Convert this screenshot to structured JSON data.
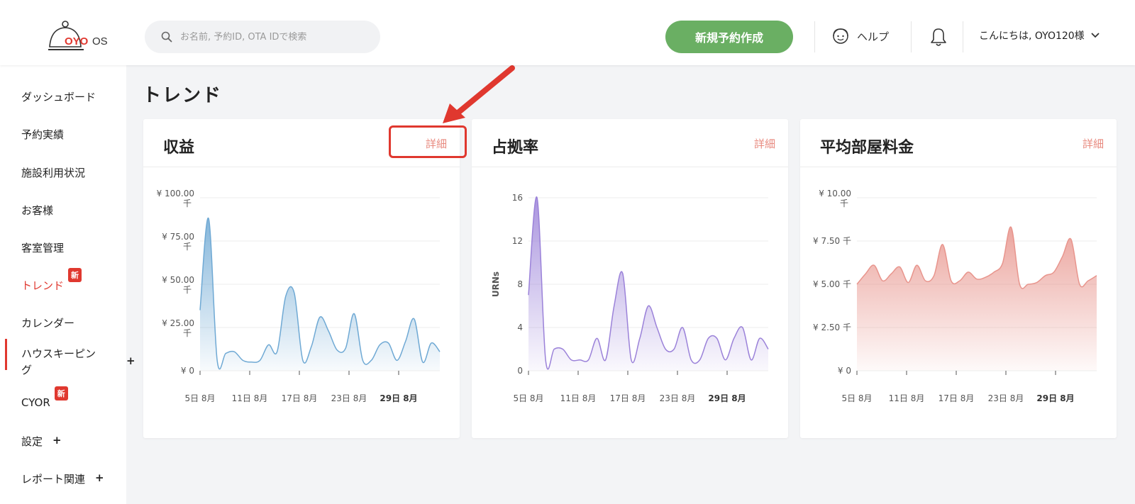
{
  "header": {
    "logo_text": "OYO OS",
    "search_placeholder": "お名前, 予約ID, OTA IDで検索",
    "new_booking_label": "新規予約作成",
    "help_label": "ヘルプ",
    "greeting": "こんにちは, OYO120様"
  },
  "sidebar": {
    "items": [
      {
        "label": "ダッシュボード"
      },
      {
        "label": "予約実績"
      },
      {
        "label": "施設利用状況"
      },
      {
        "label": "お客様"
      },
      {
        "label": "客室管理"
      },
      {
        "label": "トレンド",
        "badge": "新"
      },
      {
        "label": "カレンダー"
      },
      {
        "label": "ハウスキーピング",
        "line1": "ハウスキーピン",
        "line2": "グ",
        "plus": "+"
      },
      {
        "label": "CYOR",
        "badge": "新"
      },
      {
        "label": "設定",
        "plus": "+"
      },
      {
        "label": "レポート関連",
        "plus": "+"
      }
    ]
  },
  "main": {
    "title": "トレンド",
    "detail_label": "詳細"
  },
  "colors": {
    "accent_green": "#6aaf63",
    "accent_red": "#e0382f",
    "revenue": "#6fa9d4",
    "occupancy": "#9b82d9",
    "adr": "#e8958d"
  },
  "chart_data": [
    {
      "type": "area",
      "title": "収益",
      "ylabel": "",
      "ylim": [
        0,
        100
      ],
      "yticks": [
        {
          "value": 100,
          "line1": "¥ 100.00",
          "line2": "千"
        },
        {
          "value": 75,
          "line1": "¥ 75.00",
          "line2": "千"
        },
        {
          "value": 50,
          "line1": "¥ 50.00",
          "line2": "千"
        },
        {
          "value": 25,
          "line1": "¥ 25.00",
          "line2": "千"
        },
        {
          "value": 0,
          "line1": "¥ 0",
          "line2": ""
        }
      ],
      "xlabels": [
        "5日 8月",
        "11日 8月",
        "17日 8月",
        "23日 8月",
        "29日 8月"
      ],
      "x": [
        5,
        6,
        7,
        8,
        9,
        10,
        11,
        12,
        13,
        14,
        15,
        16,
        17,
        18,
        19,
        20,
        21,
        22,
        23,
        24,
        25,
        26,
        27,
        28,
        29,
        30,
        31
      ],
      "values": [
        35,
        88,
        6,
        10,
        11,
        6,
        5,
        6,
        15,
        11,
        43,
        45,
        6,
        14,
        31,
        23,
        12,
        13,
        33,
        6,
        6,
        15,
        16,
        6,
        17,
        30,
        5,
        16,
        11
      ]
    },
    {
      "type": "area",
      "title": "占拠率",
      "ylabel": "URNs",
      "ylim": [
        0,
        16
      ],
      "yticks": [
        {
          "value": 16,
          "line1": "16",
          "line2": ""
        },
        {
          "value": 12,
          "line1": "12",
          "line2": ""
        },
        {
          "value": 8,
          "line1": "8",
          "line2": ""
        },
        {
          "value": 4,
          "line1": "4",
          "line2": ""
        },
        {
          "value": 0,
          "line1": "0",
          "line2": ""
        }
      ],
      "xlabels": [
        "5日 8月",
        "11日 8月",
        "17日 8月",
        "23日 8月",
        "29日 8月"
      ],
      "x": [
        5,
        6,
        7,
        8,
        9,
        10,
        11,
        12,
        13,
        14,
        15,
        16,
        17,
        18,
        19,
        20,
        21,
        22,
        23,
        24,
        25,
        26,
        27,
        28,
        29,
        30,
        31
      ],
      "values": [
        7,
        16,
        1,
        2,
        2,
        1,
        1,
        1,
        3,
        1,
        6,
        9,
        1,
        3,
        6,
        4,
        2,
        2,
        4,
        1,
        1,
        3,
        3,
        1,
        3,
        4,
        1,
        3,
        2
      ]
    },
    {
      "type": "area",
      "title": "平均部屋料金",
      "ylabel": "",
      "ylim": [
        0,
        10
      ],
      "yticks": [
        {
          "value": 10,
          "line1": "¥ 10.00",
          "line2": "千"
        },
        {
          "value": 7.5,
          "line1": "¥ 7.50 千",
          "line2": ""
        },
        {
          "value": 5,
          "line1": "¥ 5.00 千",
          "line2": ""
        },
        {
          "value": 2.5,
          "line1": "¥ 2.50 千",
          "line2": ""
        },
        {
          "value": 0,
          "line1": "¥ 0",
          "line2": ""
        }
      ],
      "xlabels": [
        "5日 8月",
        "11日 8月",
        "17日 8月",
        "23日 8月",
        "29日 8月"
      ],
      "x": [
        5,
        6,
        7,
        8,
        9,
        10,
        11,
        12,
        13,
        14,
        15,
        16,
        17,
        18,
        19,
        20,
        21,
        22,
        23,
        24,
        25,
        26,
        27,
        28,
        29,
        30,
        31
      ],
      "values": [
        5.0,
        5.6,
        6.1,
        5.2,
        5.6,
        6.0,
        5.1,
        6.1,
        5.2,
        5.5,
        7.3,
        5.2,
        5.2,
        5.7,
        5.3,
        5.4,
        5.7,
        6.2,
        8.3,
        5.0,
        5.0,
        5.1,
        5.5,
        5.7,
        6.6,
        7.6,
        5.0,
        5.2,
        5.5
      ]
    }
  ]
}
